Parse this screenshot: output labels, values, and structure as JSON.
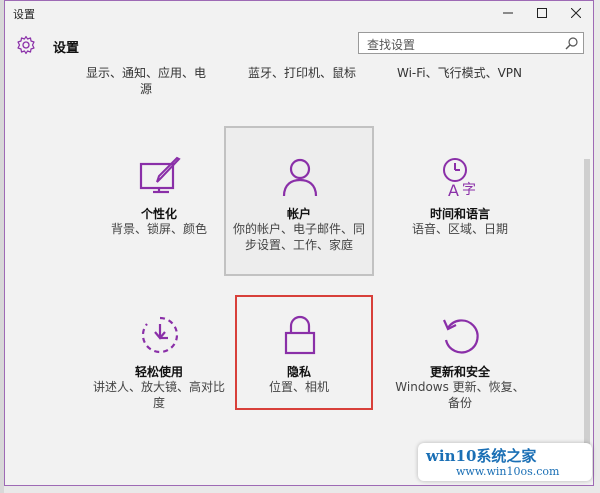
{
  "window": {
    "title": "设置",
    "min_icon": "minimize-icon",
    "max_icon": "maximize-icon",
    "close_icon": "close-icon"
  },
  "header": {
    "title": "设置",
    "icon": "gear-icon"
  },
  "search": {
    "placeholder": "查找设置",
    "icon": "search-icon"
  },
  "top_categories": [
    {
      "label": "显示、通知、应用、电源"
    },
    {
      "label": "蓝牙、打印机、鼠标"
    },
    {
      "label": "Wi-Fi、飞行模式、VPN"
    }
  ],
  "tiles": [
    {
      "name": "个性化",
      "desc": "背景、锁屏、颜色",
      "icon": "personalization-icon"
    },
    {
      "name": "帐户",
      "desc": "你的帐户、电子邮件、同步设置、工作、家庭",
      "icon": "account-icon"
    },
    {
      "name": "时间和语言",
      "desc": "语音、区域、日期",
      "icon": "time-language-icon"
    },
    {
      "name": "轻松使用",
      "desc": "讲述人、放大镜、高对比度",
      "icon": "ease-of-access-icon"
    },
    {
      "name": "隐私",
      "desc": "位置、相机",
      "icon": "privacy-lock-icon"
    },
    {
      "name": "更新和安全",
      "desc": "Windows 更新、恢复、备份",
      "icon": "update-security-icon"
    }
  ],
  "watermark": {
    "line1": "win10系统之家",
    "line2": "www.win10os.com"
  },
  "colors": {
    "accent": "#8a2fa8",
    "highlight_box": "#d8403a",
    "watermark": "#1a6fb5"
  }
}
